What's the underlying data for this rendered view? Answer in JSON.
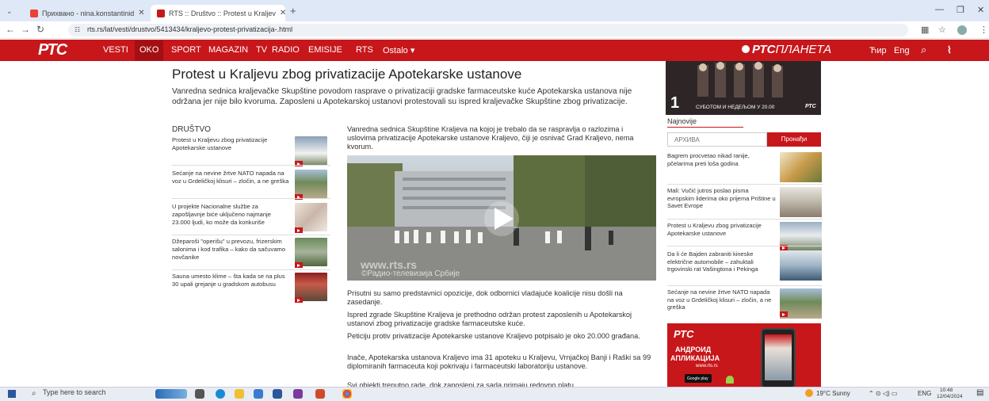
{
  "browser": {
    "tabs": [
      {
        "label": "Прихвано - nina.konstantinid",
        "icon": "gmail-icon",
        "color": "#ea4335"
      },
      {
        "label": "RTS :: Društvo :: Protest u Kraljev",
        "icon": "rts-icon",
        "color": "#c7171b"
      }
    ],
    "new_tab": "+",
    "url": "rts.rs/lat/vesti/drustvo/5413434/kraljevo-protest-privatizacija-.html"
  },
  "nav": {
    "logo": "РТС",
    "items": [
      "VESTI",
      "OKO",
      "SPORT",
      "MAGAZIN",
      "TV",
      "RADIO",
      "EMISIJE",
      "RTS",
      "Ostalo ▾"
    ],
    "active": "OKO",
    "planeta_bold": "РТС",
    "planeta_rest": "ПЛАНЕТА",
    "right": [
      "Ћир",
      "Eng"
    ]
  },
  "article": {
    "title": "Protest u Kraljevu zbog privatizacije Apotekarske ustanove",
    "lead": "Vanredna sednica kraljevačke Skupštine povodom rasprave o privatizaciji gradske farmaceutske kuće Apotekarska ustanova nije održana jer nije bilo kvoruma. Zaposleni u Apotekarskoj ustanovi protestovali su ispred kraljevačke Skupštine zbog privatizacije.",
    "section": "DRUŠTVO",
    "related": [
      "Protest u Kraljevu zbog privatizacije Apotekarske ustanove",
      "Sećanje na nevine žrtve NATO napada na voz u Grdeličkoj klisuri – zločin, a ne greška",
      "U projekte Nacionalne službe za zapošljavnje biće uključeno najmanje 23.000 ljudi, ko može da konkuriše",
      "Džeparoši \"operišu\" u prevozu, frizerskim salonima i kod trafika – kako da sačuvamo novčanike",
      "Sauna umesto klime – šta kada se na plus 30 upali grejanje u gradskom autobusu"
    ],
    "paragraphs": [
      "Vanredna sednica Skupštine Kraljeva na kojoj je trebalo da se raspravlja o razlozima i uslovima privatizacije Apotekarske ustanove Kraljevo, čiji je osnivač Grad Kraljevo, nema kvorum.",
      "Prisutni su samo predstavnici opozicije, dok odbornici vladajuće koalicije nisu došli na zasedanje.",
      "Ispred zgrade Skupštine Kraljeva je prethodno održan protest zaposlenih u Apotekarskoj ustanovi zbog privatizacije gradske farmaceutske kuće.",
      "Peticiju protiv privatizacije Apotekarske ustanove Kraljevo potpisalo je oko 20.000 građana.",
      "Inače, Apotekarska ustanova Kraljevo ima 31 apoteku u Kraljevu, Vrnjačkoj Banji i Raški sa 99 diplomiranih farmaceuta koji pokrivaju i farmaceutski laboratoriju ustanove.",
      "Svi objekti trenutno rade, dok zaposleni za sada primaju redovno platu."
    ],
    "video_watermark": "www.rts.rs",
    "video_caption": "©Радио-телевизија Србије"
  },
  "sidebar": {
    "ad_text": "СУБОТОМ И НЕДЕЉОМ У 20.00",
    "ad_num": "1",
    "ad_brand": "РТС",
    "latest_label": "Najnovije",
    "search_placeholder": "АРХИВА",
    "search_button": "Пронађи",
    "news": [
      "Bagrem procvetao nikad ranije, pčelarima preti loša godina",
      "Mali: Vučić jutros poslao pisma evropskim liderima oko prijema Prištine u Savet Evrope",
      "Protest u Kraljevu zbog privatizacije Apotekarske ustanove",
      "Da li će Bajden zabraniti kineske električne automobile – zahuktali trgovinski rat Vašingtona i Pekinga",
      "Sećanje na nevine žrtve NATO napada na voz u Grdeličkoj klisuri – zločin, a ne greška"
    ],
    "app_ad": {
      "brand": "РТС",
      "line1": "АНДРОИД",
      "line2": "АПЛИКАЦИЈА",
      "url": "www.rts.rs",
      "store": "Google play"
    }
  },
  "taskbar": {
    "search": "Type here to search",
    "weather": "19°C  Sunny",
    "lang": "ENG",
    "time": "10:48",
    "date": "12/04/2024"
  }
}
